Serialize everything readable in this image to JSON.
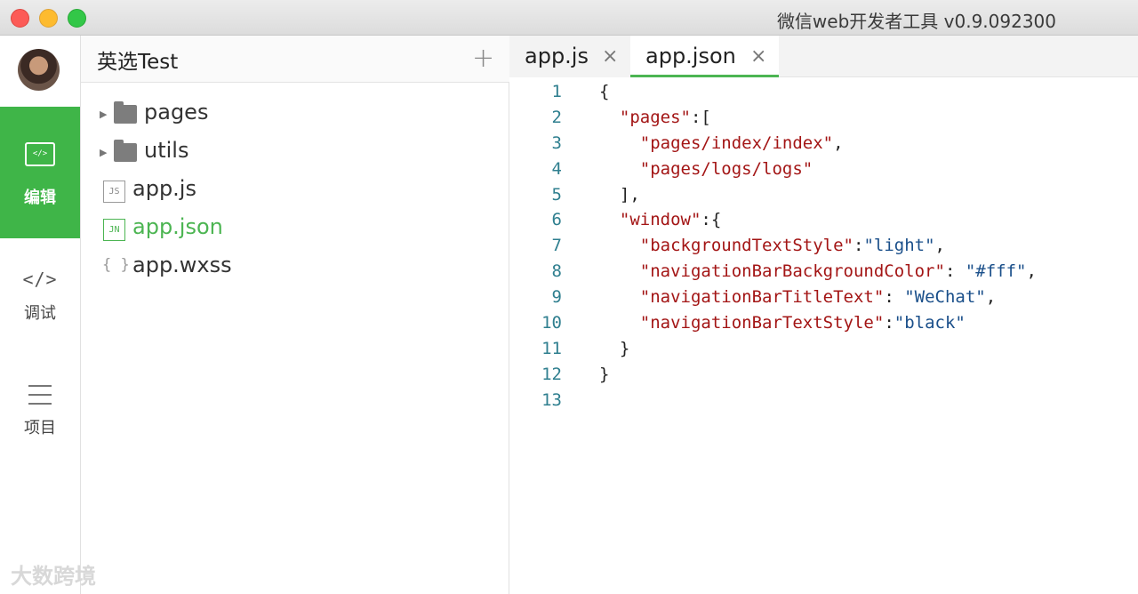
{
  "window": {
    "title": "微信web开发者工具 v0.9.092300"
  },
  "leftnav": {
    "items": [
      {
        "label": "编辑",
        "icon": "code-box-icon",
        "active": true
      },
      {
        "label": "调试",
        "icon": "code-brackets-icon",
        "glyph": "</>"
      },
      {
        "label": "项目",
        "icon": "menu-lines-icon"
      }
    ],
    "edit_glyph": "</>"
  },
  "filepanel": {
    "project_name": "英选Test",
    "add_label": "+",
    "tree": [
      {
        "type": "folder",
        "name": "pages"
      },
      {
        "type": "folder",
        "name": "utils"
      },
      {
        "type": "file",
        "name": "app.js",
        "badge": "JS"
      },
      {
        "type": "file",
        "name": "app.json",
        "badge": "JN",
        "active": true
      },
      {
        "type": "file",
        "name": "app.wxss",
        "badge": "{ }"
      }
    ]
  },
  "editor": {
    "tabs": [
      {
        "label": "app.js",
        "close": "×"
      },
      {
        "label": "app.json",
        "close": "×",
        "active": true
      }
    ],
    "line_numbers": [
      "1",
      "2",
      "3",
      "4",
      "5",
      "6",
      "7",
      "8",
      "9",
      "10",
      "11",
      "12",
      "13"
    ],
    "lines": [
      "{",
      "  \"pages\":[",
      "    \"pages/index/index\",",
      "    \"pages/logs/logs\"",
      "  ],",
      "  \"window\":{",
      "    \"backgroundTextStyle\":\"light\",",
      "    \"navigationBarBackgroundColor\": \"#fff\",",
      "    \"navigationBarTitleText\": \"WeChat\",",
      "    \"navigationBarTextStyle\":\"black\"",
      "  }",
      "}",
      ""
    ]
  },
  "watermark": "大数跨境",
  "colors": {
    "accent": "#3fb548",
    "line_number": "#2f7f8f"
  }
}
